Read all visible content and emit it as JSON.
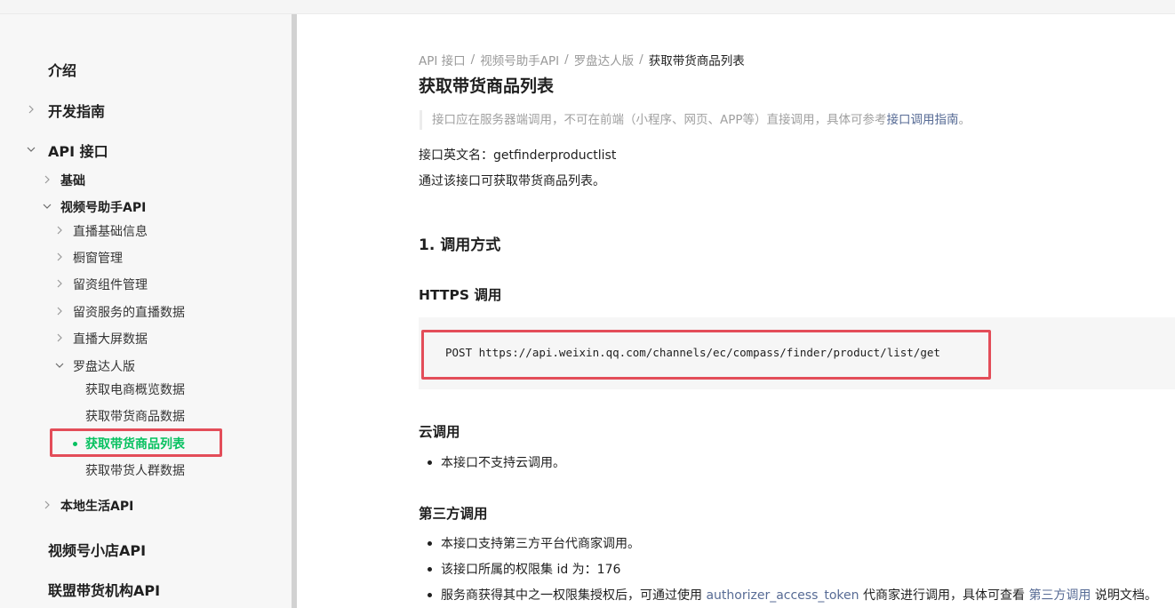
{
  "sidebar": {
    "intro": "介绍",
    "dev_guide": "开发指南",
    "api": "API 接口",
    "basic": "基础",
    "channels_assistant": "视频号助手API",
    "live_info": "直播基础信息",
    "showcase": "橱窗管理",
    "leads_component": "留资组件管理",
    "leads_live_data": "留资服务的直播数据",
    "live_screen": "直播大屏数据",
    "compass": "罗盘达人版",
    "ecom_overview": "获取电商概览数据",
    "product_data": "获取带货商品数据",
    "product_list": "获取带货商品列表",
    "audience_data": "获取带货人群数据",
    "local_life": "本地生活API",
    "shop_api": "视频号小店API",
    "alliance_api": "联盟带货机构API"
  },
  "breadcrumb": {
    "items": [
      "API 接口",
      "视频号助手API",
      "罗盘达人版"
    ],
    "current": "获取带货商品列表",
    "separator": "/"
  },
  "page": {
    "title": "获取带货商品列表",
    "notice_text": "接口应在服务器端调用，不可在前端（小程序、网页、APP等）直接调用，具体可参考",
    "notice_link": "接口调用指南",
    "notice_end": "。",
    "english_name": "接口英文名：getfinderproductlist",
    "description": "通过该接口可获取带货商品列表。"
  },
  "section_call": {
    "heading": "1. 调用方式",
    "https_heading": "HTTPS 调用",
    "code": "POST https://api.weixin.qq.com/channels/ec/compass/finder/product/list/get",
    "cloud_heading": "云调用",
    "cloud_item": "本接口不支持云调用。",
    "third_heading": "第三方调用",
    "third_items": [
      "本接口支持第三方平台代商家调用。",
      "该接口所属的权限集 id 为：176"
    ],
    "third_item3_pre": "服务商获得其中之一权限集授权后，可通过使用 ",
    "third_item3_link1": "authorizer_access_token",
    "third_item3_mid": " 代商家进行调用，具体可查看 ",
    "third_item3_link2": "第三方调用",
    "third_item3_post": " 说明文档。"
  },
  "colors": {
    "accent": "#07c160",
    "link": "#576b95",
    "highlight_box": "#e34d59"
  },
  "icons": {
    "collapsed": "chevron-right-icon",
    "expanded": "chevron-down-icon"
  }
}
